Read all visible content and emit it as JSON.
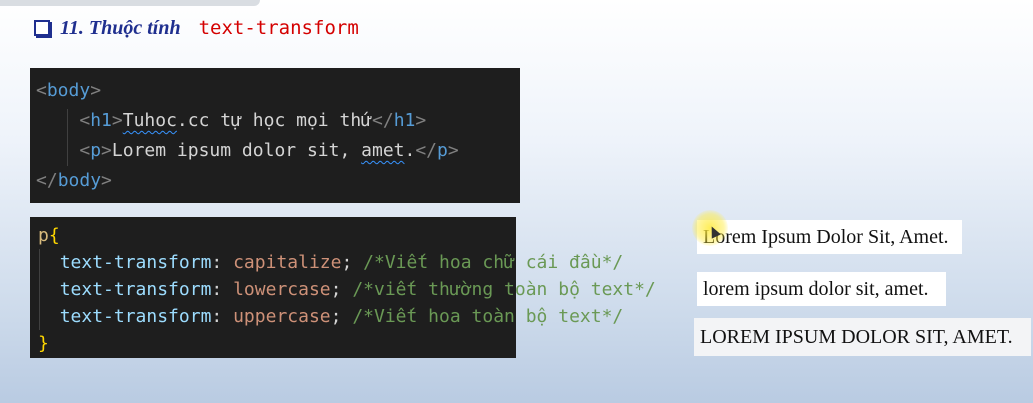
{
  "heading": {
    "title": "11. Thuộc tính",
    "code": "text-transform"
  },
  "html_code": {
    "line1_tag": "body",
    "line2_tag": "h1",
    "line2_text_a": "Tuhoc",
    "line2_text_b": ".cc tự học mọi thứ",
    "line3_tag": "p",
    "line3_text_a": "Lorem ipsum dolor sit, ",
    "line3_text_b": "amet",
    "line3_text_c": ".",
    "line4_tag": "body"
  },
  "css_code": {
    "selector": "p",
    "open": "{",
    "close": "}",
    "rules": [
      {
        "prop": "text-transform",
        "value": "capitalize",
        "comment": "/*Viết hoa chữ cái đầu*/"
      },
      {
        "prop": "text-transform",
        "value": "lowercase",
        "comment": "/*viết thường toàn bộ text*/"
      },
      {
        "prop": "text-transform",
        "value": "uppercase",
        "comment": "/*Viết hoa toàn bộ text*/"
      }
    ]
  },
  "output": {
    "capitalize": "Lorem Ipsum Dolor Sit, Amet.",
    "lowercase": "lorem ipsum dolor sit, amet.",
    "uppercase": "LOREM IPSUM DOLOR SIT, AMET."
  },
  "colors": {
    "heading": "#1f2f8f",
    "heading_code": "#d40000",
    "editor_bg": "#1e1e1e",
    "cursor_highlight": "#ffeb3c"
  }
}
